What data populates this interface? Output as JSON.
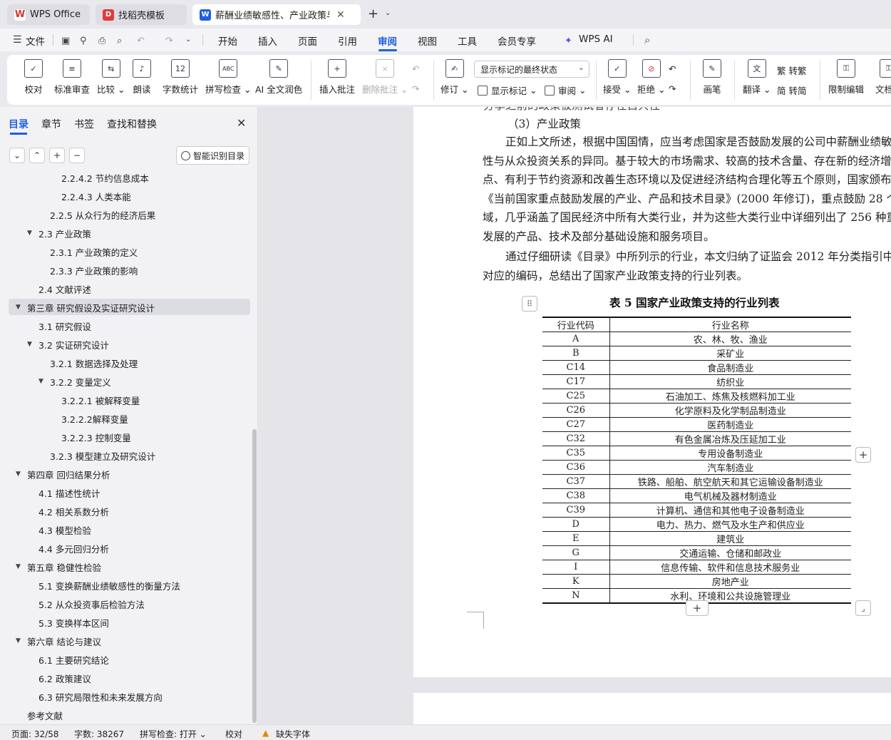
{
  "tabs": [
    {
      "label": "WPS Office",
      "icon": "wps-logo-icon",
      "color": "#d9342b"
    },
    {
      "label": "找稻壳模板",
      "icon": "docer-icon",
      "color": "#e23a3a"
    },
    {
      "label": "薪酬业绩敏感性、产业政策与…",
      "icon": "word-doc-icon",
      "color": "#1f5fe0"
    }
  ],
  "menubar": {
    "file": "文件",
    "items": [
      "开始",
      "插入",
      "页面",
      "引用",
      "审阅",
      "视图",
      "工具",
      "会员专享",
      "WPS AI"
    ],
    "active": "审阅"
  },
  "ribbon": {
    "proofread": "校对",
    "standard_review": "标准审查",
    "compare": "比较",
    "read_aloud": "朗读",
    "word_count": "字数统计",
    "spell_check": "拼写检查",
    "ai_polish": "AI 全文润色",
    "insert_comment": "插入批注",
    "delete_comment": "删除批注",
    "track_changes": "修订",
    "markup_select": "显示标记的最终状态",
    "show_markup": "显示标记",
    "review": "审阅",
    "accept": "接受",
    "reject": "拒绝",
    "pen": "画笔",
    "translate": "翻译",
    "to_traditional": "转繁",
    "to_simplified": "转简",
    "restrict_edit": "限制编辑",
    "doc_permission": "文档权"
  },
  "nav": {
    "tabs": [
      "目录",
      "章节",
      "书签",
      "查找和替换"
    ],
    "active_tab": "目录",
    "smart_toc": "智能识别目录",
    "items": [
      {
        "label": "2.2.4.2  节约信息成本",
        "level": 4,
        "tri": ""
      },
      {
        "label": "2.2.4.3  人类本能",
        "level": 4,
        "tri": ""
      },
      {
        "label": "2.2.5  从众行为的经济后果",
        "level": 3,
        "tri": ""
      },
      {
        "label": "2.3  产业政策",
        "level": 2,
        "tri": "▼"
      },
      {
        "label": "2.3.1  产业政策的定义",
        "level": 3,
        "tri": ""
      },
      {
        "label": "2.3.3  产业政策的影响",
        "level": 3,
        "tri": ""
      },
      {
        "label": "2.4  文献评述",
        "level": 2,
        "tri": ""
      },
      {
        "label": "第三章  研究假设及实证研究设计",
        "level": 1,
        "tri": "▼",
        "selected": true
      },
      {
        "label": "3.1  研究假设",
        "level": 2,
        "tri": ""
      },
      {
        "label": "3.2  实证研究设计",
        "level": 2,
        "tri": "▼"
      },
      {
        "label": "3.2.1  数据选择及处理",
        "level": 3,
        "tri": ""
      },
      {
        "label": "3.2.2  变量定义",
        "level": 3,
        "tri": "▼"
      },
      {
        "label": "3.2.2.1  被解释变量",
        "level": 4,
        "tri": ""
      },
      {
        "label": "3.2.2.2解释变量",
        "level": 4,
        "tri": ""
      },
      {
        "label": "3.2.2.3  控制变量",
        "level": 4,
        "tri": ""
      },
      {
        "label": "3.2.3  模型建立及研究设计",
        "level": 3,
        "tri": ""
      },
      {
        "label": "第四章  回归结果分析",
        "level": 1,
        "tri": "▼"
      },
      {
        "label": "4.1  描述性统计",
        "level": 2,
        "tri": ""
      },
      {
        "label": "4.2  相关系数分析",
        "level": 2,
        "tri": ""
      },
      {
        "label": "4.3  模型检验",
        "level": 2,
        "tri": ""
      },
      {
        "label": "4.4  多元回归分析",
        "level": 2,
        "tri": ""
      },
      {
        "label": "第五章  稳健性检验",
        "level": 1,
        "tri": "▼"
      },
      {
        "label": "5.1  变换薪酬业绩敏感性的衡量方法",
        "level": 2,
        "tri": ""
      },
      {
        "label": "5.2  从众投资事后检验方法",
        "level": 2,
        "tri": ""
      },
      {
        "label": "5.3  变换样本区间",
        "level": 2,
        "tri": ""
      },
      {
        "label": "第六章  结论与建议",
        "level": 1,
        "tri": "▼"
      },
      {
        "label": "6.1  主要研究结论",
        "level": 2,
        "tri": ""
      },
      {
        "label": "6.2  政策建议",
        "level": 2,
        "tri": ""
      },
      {
        "label": "6.3  研究局限性和未来发展方向",
        "level": 2,
        "tri": ""
      },
      {
        "label": "参考文献",
        "level": 1,
        "tri": ""
      }
    ]
  },
  "document": {
    "top_cut": "分享之前的政策被测试者存在自共性",
    "heading": "（3）产业政策",
    "para1": [
      "正如上文所述，根据中国国情，应当考虑国家是否鼓励发展的公司中薪酬业绩敏",
      "性与从众投资关系的异同。基于较大的市场需求、较高的技术含量、存在新的经济增",
      "点、有利于节约资源和改善生态环境以及促进经济结构合理化等五个原则，国家颁布",
      "《当前国家重点鼓励发展的产业、产品和技术目录》(2000 年修订)，重点鼓励 28 个",
      "域，几乎涵盖了国民经济中所有大类行业，并为这些大类行业中详细列出了 256 种重",
      "发展的产品、技术及部分基础设施和服务项目。"
    ],
    "para2": [
      "通过仔细研读《目录》中所列示的行业，本文归纳了证监会 2012 年分类指引中",
      "对应的编码，总结出了国家产业政策支持的行业列表。"
    ],
    "table_title": "表 5 国家产业政策支持的行业列表",
    "table_headers": [
      "行业代码",
      "行业名称"
    ],
    "table_rows": [
      [
        "A",
        "农、林、牧、渔业"
      ],
      [
        "B",
        "采矿业"
      ],
      [
        "C14",
        "食品制造业"
      ],
      [
        "C17",
        "纺织业"
      ],
      [
        "C25",
        "石油加工、炼焦及核燃料加工业"
      ],
      [
        "C26",
        "化学原料及化学制品制造业"
      ],
      [
        "C27",
        "医药制造业"
      ],
      [
        "C32",
        "有色金属冶炼及压延加工业"
      ],
      [
        "C35",
        "专用设备制造业"
      ],
      [
        "C36",
        "汽车制造业"
      ],
      [
        "C37",
        "铁路、船舶、航空航天和其它运输设备制造业"
      ],
      [
        "C38",
        "电气机械及器材制造业"
      ],
      [
        "C39",
        "计算机、通信和其他电子设备制造业"
      ],
      [
        "D",
        "电力、热力、燃气及水生产和供应业"
      ],
      [
        "E",
        "建筑业"
      ],
      [
        "G",
        "交通运输、仓储和邮政业"
      ],
      [
        "I",
        "信息传输、软件和信息技术服务业"
      ],
      [
        "K",
        "房地产业"
      ],
      [
        "N",
        "水利、环境和公共设施管理业"
      ]
    ]
  },
  "status": {
    "page": "页面: 32/58",
    "words": "字数: 38267",
    "spell": "拼写检查: 打开",
    "proof": "校对",
    "missing_font": "缺失字体"
  }
}
